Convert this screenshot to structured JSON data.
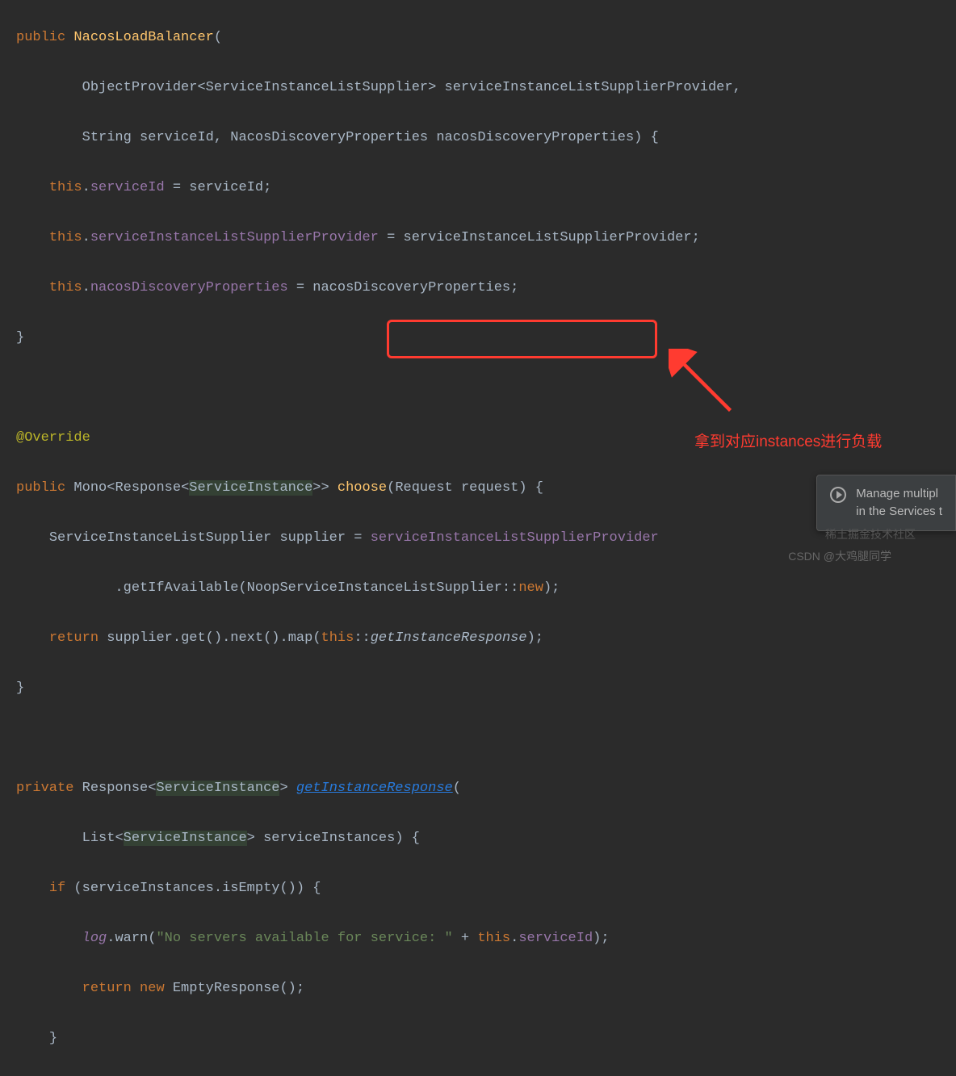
{
  "code": {
    "l1": {
      "kw": "public",
      "cls": "NacosLoadBalancer",
      "paren": "("
    },
    "l2": {
      "t1": "ObjectProvider",
      "lt": "<",
      "t2": "ServiceInstanceListSupplier",
      "gt": ">",
      "sp": " ",
      "p1": "serviceInstanceListSupplierProvider",
      "comma": ","
    },
    "l3": {
      "t1": "String",
      "p1": "serviceId",
      "c1": ", ",
      "t2": "NacosDiscoveryProperties",
      "p2": "nacosDiscoveryProperties",
      "close": ") {"
    },
    "l4": {
      "kw": "this",
      "dot": ".",
      "f1": "serviceId",
      "eq": " = ",
      "p1": "serviceId",
      "semi": ";"
    },
    "l5": {
      "kw": "this",
      "dot": ".",
      "f1": "serviceInstanceListSupplierProvider",
      "eq": " = ",
      "p1": "serviceInstanceListSupplierProvider",
      "semi": ";"
    },
    "l6": {
      "kw": "this",
      "dot": ".",
      "f1": "nacosDiscoveryProperties",
      "eq": " = ",
      "p1": "nacosDiscoveryProperties",
      "semi": ";"
    },
    "l7": {
      "brace": "}"
    },
    "l8": {
      "empty": ""
    },
    "l9": {
      "ann": "@Override"
    },
    "l10": {
      "kw": "public",
      "t1": "Mono",
      "lt": "<",
      "t2": "Response",
      "lt2": "<",
      "t3": "ServiceInstance",
      "gt2": ">>",
      "sp": " ",
      "m": "choose",
      "paren": "(",
      "t4": "Request",
      "p1": "request",
      "close": ") {"
    },
    "l11": {
      "t1": "ServiceInstanceListSupplier",
      "p1": "supplier",
      "eq": " = ",
      "f1": "serviceInstanceListSupplierProvider"
    },
    "l12": {
      "dot": ".",
      "m": "getIfAvailable",
      "paren": "(",
      "t1": "NoopServiceInstanceListSupplier",
      "dcolon": "::",
      "kw": "new",
      "close": ");"
    },
    "l13": {
      "kw": "return",
      "p1": "supplier",
      "d1": ".",
      "m1": "get",
      "p2": "()",
      "d2": ".",
      "m2": "next",
      "p3": "()",
      "d3": ".",
      "m3": "map",
      "paren": "(",
      "kw2": "this",
      "dcolon": "::",
      "m4": "getInstanceResponse",
      "close": ");"
    },
    "l14": {
      "brace": "}"
    },
    "l15": {
      "empty": ""
    },
    "l16": {
      "kw": "private",
      "t1": "Response",
      "lt": "<",
      "t2": "ServiceInstance",
      "gt": ">",
      "sp": " ",
      "m": "getInstanceResponse",
      "paren": "("
    },
    "l17": {
      "t1": "List",
      "lt": "<",
      "t2": "ServiceInstance",
      "gt": ">",
      "p1": "serviceInstances",
      "close": ") {"
    },
    "l18": {
      "kw": "if",
      "paren": " (",
      "p1": "serviceInstances",
      "dot": ".",
      "m": "isEmpty",
      "close": "()) {"
    },
    "l19": {
      "f1": "log",
      "dot": ".",
      "m": "warn",
      "paren": "(",
      "str": "\"No servers available for service: \"",
      "plus": " + ",
      "kw": "this",
      "dot2": ".",
      "f2": "serviceId",
      "close": ");"
    },
    "l20": {
      "kw": "return",
      "sp": " ",
      "kw2": "new",
      "t1": "EmptyResponse",
      "close": "();"
    },
    "l21": {
      "brace": "}"
    }
  },
  "annotation": {
    "text": "拿到对应instances进行负载"
  },
  "popup": {
    "line1": "Manage multipl",
    "line2": "in the Services t"
  },
  "watermark": {
    "text1": "CSDN @大鸡腿同学",
    "text2": "稀土掘金技术社区"
  }
}
